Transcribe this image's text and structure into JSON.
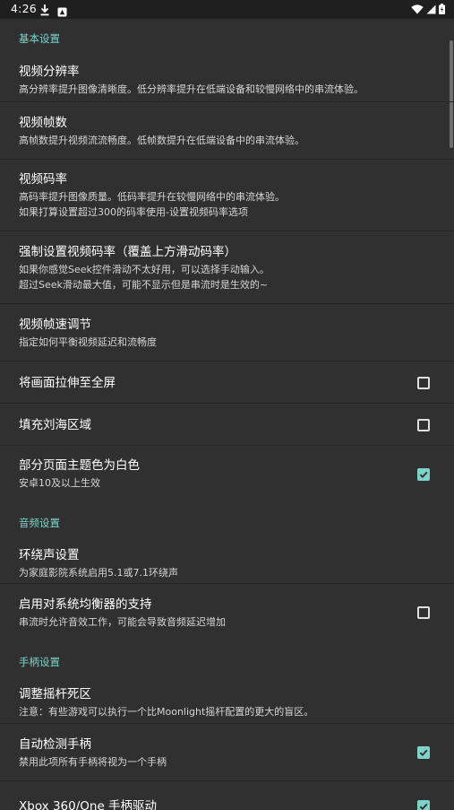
{
  "status_bar": {
    "time": "4:26"
  },
  "sections": {
    "basic": {
      "header": "基本设置",
      "items": [
        {
          "title": "视频分辨率",
          "summary": "高分辨率提升图像清晰度。低分辨率提升在低端设备和较慢网络中的串流体验。"
        },
        {
          "title": "视频帧数",
          "summary": "高帧数提升视频流流畅度。低帧数提升在低端设备中的串流体验。"
        },
        {
          "title": "视频码率",
          "summary_line1": "高码率提升图像质量。低码率提升在较慢网络中的串流体验。",
          "summary_line2": "如果打算设置超过300的码率使用-设置视频码率选项"
        },
        {
          "title": "强制设置视频码率（覆盖上方滑动码率）",
          "summary_line1": "如果你感觉Seek控件滑动不太好用，可以选择手动输入。",
          "summary_line2": "超过Seek滑动最大值，可能不显示但是串流时是生效的~"
        },
        {
          "title": "视频帧速调节",
          "summary": "指定如何平衡视频延迟和流畅度"
        },
        {
          "title": "将画面拉伸至全屏",
          "checked": false
        },
        {
          "title": "填充刘海区域",
          "checked": false
        },
        {
          "title": "部分页面主题色为白色",
          "summary": "安卓10及以上生效",
          "checked": true
        }
      ]
    },
    "audio": {
      "header": "音频设置",
      "items": [
        {
          "title": "环绕声设置",
          "summary": "为家庭影院系统启用5.1或7.1环绕声"
        },
        {
          "title": "启用对系统均衡器的支持",
          "summary": "串流时允许音效工作，可能会导致音频延迟增加",
          "checked": false
        }
      ]
    },
    "gamepad": {
      "header": "手柄设置",
      "items": [
        {
          "title": "调整摇杆死区",
          "summary": "注意：有些游戏可以执行一个比Moonlight摇杆配置的更大的盲区。"
        },
        {
          "title": "自动检测手柄",
          "summary": "禁用此项所有手柄将视为一个手柄",
          "checked": true
        },
        {
          "title": "Xbox 360/One 手柄驱动",
          "checked": true
        }
      ]
    }
  },
  "colors": {
    "accent": "#7dd3c9",
    "background": "#303030",
    "status_bar": "#1f1f1f"
  }
}
